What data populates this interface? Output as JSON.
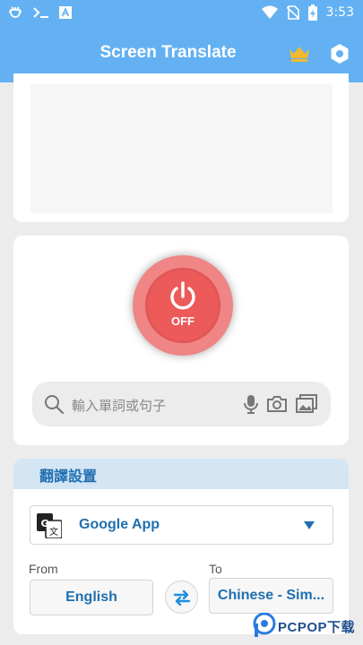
{
  "status_bar": {
    "time": "3:53",
    "icons": [
      "bug-icon",
      "terminal-icon",
      "a-box-icon",
      "wifi-icon",
      "no-sim-icon",
      "battery-charging-icon"
    ]
  },
  "app_bar": {
    "title": "Screen Translate",
    "icons": [
      "crown-icon",
      "settings-hexagon-icon"
    ]
  },
  "power": {
    "state_label": "OFF"
  },
  "search": {
    "placeholder": "輸入單詞或句子",
    "icons": [
      "search-icon",
      "mic-icon",
      "camera-icon",
      "gallery-icon"
    ]
  },
  "settings": {
    "title": "翻譯設置",
    "engine": "Google App",
    "from_label": "From",
    "to_label": "To",
    "from_language": "English",
    "to_language": "Chinese - Sim..."
  },
  "watermark": {
    "text": "PCPOP下载"
  },
  "colors": {
    "primary": "#63b1f2",
    "accent_text": "#1f6fb0",
    "power_off": "#ec5a5a",
    "crown": "#f5b92e"
  }
}
